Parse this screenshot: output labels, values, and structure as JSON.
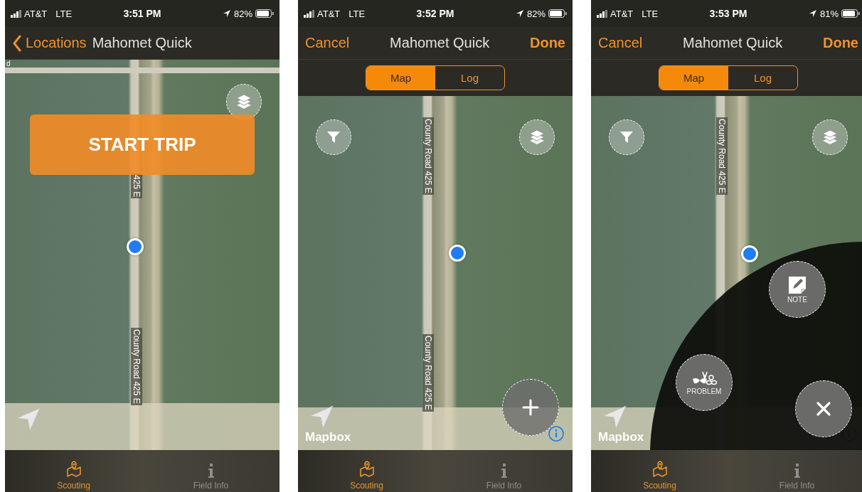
{
  "screens": [
    {
      "status_bar": {
        "carrier": "AT&T",
        "network": "LTE",
        "time": "3:51 PM",
        "battery": "82%"
      },
      "nav": {
        "left": {
          "kind": "back",
          "label": "Locations"
        },
        "title": "Mahomet Quick"
      },
      "map": {
        "corner_label": "d",
        "road_labels": [
          "425 E",
          "County Road 425 E"
        ],
        "controls": [
          {
            "kind": "layers"
          },
          {
            "kind": "start",
            "label": "START TRIP"
          },
          {
            "kind": "locate"
          }
        ]
      },
      "tabs": [
        {
          "label": "Scouting",
          "selected": true
        },
        {
          "label": "Field Info",
          "selected": false
        }
      ]
    },
    {
      "status_bar": {
        "carrier": "AT&T",
        "network": "LTE",
        "time": "3:52 PM",
        "battery": "82%"
      },
      "nav": {
        "left": {
          "kind": "text",
          "label": "Cancel"
        },
        "title": "Mahomet Quick",
        "right": "Done"
      },
      "segments": [
        {
          "label": "Map",
          "selected": true
        },
        {
          "label": "Log",
          "selected": false
        }
      ],
      "map": {
        "road_labels": [
          "County Road 425 E",
          "County Road 425 E"
        ],
        "attribution": "Mapbox",
        "controls": [
          {
            "kind": "filter"
          },
          {
            "kind": "layers"
          },
          {
            "kind": "locate"
          },
          {
            "kind": "add"
          },
          {
            "kind": "info"
          }
        ]
      },
      "tabs": [
        {
          "label": "Scouting",
          "selected": true
        },
        {
          "label": "Field Info",
          "selected": false
        }
      ]
    },
    {
      "status_bar": {
        "carrier": "AT&T",
        "network": "LTE",
        "time": "3:53 PM",
        "battery": "81%"
      },
      "nav": {
        "left": {
          "kind": "text",
          "label": "Cancel"
        },
        "title": "Mahomet Quick",
        "right": "Done"
      },
      "segments": [
        {
          "label": "Map",
          "selected": true
        },
        {
          "label": "Log",
          "selected": false
        }
      ],
      "map": {
        "road_labels": [
          "County Road 425 E"
        ],
        "attribution": "Mapbox",
        "controls": [
          {
            "kind": "filter"
          },
          {
            "kind": "layers"
          },
          {
            "kind": "locate"
          },
          {
            "kind": "info"
          }
        ],
        "menu": {
          "open": true,
          "items": [
            {
              "kind": "note",
              "label": "NOTE"
            },
            {
              "kind": "problem",
              "label": "PROBLEM"
            }
          ]
        }
      },
      "tabs": [
        {
          "label": "Scouting",
          "selected": true
        },
        {
          "label": "Field Info",
          "selected": false
        }
      ]
    }
  ]
}
